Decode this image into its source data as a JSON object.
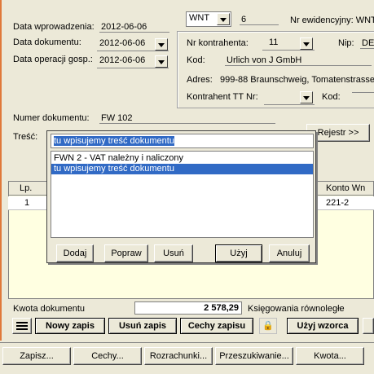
{
  "form": {
    "data_wprowadzenia_label": "Data wprowadzenia:",
    "data_wprowadzenia_value": "2012-06-06",
    "data_dokumentu_label": "Data dokumentu:",
    "data_dokumentu_value": "2012-06-06",
    "data_operacji_label": "Data operacji gosp.:",
    "data_operacji_value": "2012-06-06",
    "doc_type": "WNT",
    "doc_number": "6",
    "nr_ewidencyjny_label": "Nr ewidencyjny: WNT",
    "nr_kontrahenta_label": "Nr kontrahenta:",
    "nr_kontrahenta_value": "11",
    "nip_label": "Nip:",
    "nip_value": "DE",
    "kod_label": "Kod:",
    "kod_value": "Urlich von J GmbH",
    "adres_label": "Adres:",
    "adres_value": "999-88 Braunschweig, Tomatenstrasse",
    "kontrahent_tt_label": "Kontrahent TT Nr:",
    "kod2_label": "Kod:",
    "numer_dokumentu_label": "Numer dokumentu:",
    "numer_dokumentu_value": "FW 102",
    "tresc_label": "Treść:",
    "rejestr_button": "Rejestr >>"
  },
  "popup": {
    "input_value": "tu wpisujemy treść dokumentu",
    "items": [
      "FWN 2 - VAT należny i naliczony",
      "tu wpisujemy treść dokumentu"
    ],
    "selected_index": 1,
    "buttons": {
      "dodaj": "Dodaj",
      "popraw": "Popraw",
      "usun": "Usuń",
      "uzyj": "Użyj",
      "anuluj": "Anuluj"
    }
  },
  "grid": {
    "headers": {
      "lp": "Lp.",
      "konto_wn": "Konto Wn"
    },
    "rows": [
      {
        "lp": "1",
        "konto_wn": "221-2"
      }
    ]
  },
  "footer": {
    "kwota_label": "Kwota dokumentu",
    "kwota_value": "2 578,29",
    "ksiegowania_label": "Księgowania równoległe",
    "nowy_zapis": "Nowy zapis",
    "usun_zapis": "Usuń zapis",
    "cechy_zapisu": "Cechy zapisu",
    "uzyj_wzorca": "Użyj wzorca"
  },
  "bottom_bar": {
    "zapisz": "Zapisz...",
    "cechy": "Cechy...",
    "rozrachunki": "Rozrachunki...",
    "przeszukiwanie": "Przeszukiwanie...",
    "kwota": "Kwota..."
  }
}
